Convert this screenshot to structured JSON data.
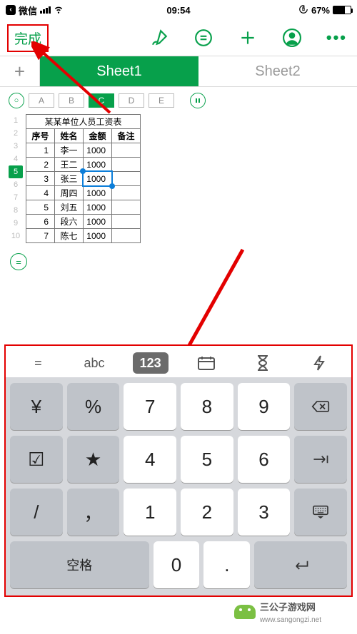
{
  "statusbar": {
    "app": "微信",
    "time": "09:54",
    "battery_pct": "67%"
  },
  "toolbar": {
    "done_label": "完成"
  },
  "sheets": {
    "tab1": "Sheet1",
    "tab2": "Sheet2"
  },
  "cols": {
    "A": "A",
    "B": "B",
    "C": "C",
    "D": "D",
    "E": "E"
  },
  "table": {
    "title": "某某单位人员工资表",
    "headers": {
      "no": "序号",
      "name": "姓名",
      "amount": "金额",
      "note": "备注"
    },
    "rows": [
      {
        "no": "1",
        "name": "李一",
        "amount": "1000",
        "note": ""
      },
      {
        "no": "2",
        "name": "王二",
        "amount": "1000",
        "note": ""
      },
      {
        "no": "3",
        "name": "张三",
        "amount": "1000",
        "note": ""
      },
      {
        "no": "4",
        "name": "周四",
        "amount": "1000",
        "note": ""
      },
      {
        "no": "5",
        "name": "刘五",
        "amount": "1000",
        "note": ""
      },
      {
        "no": "6",
        "name": "段六",
        "amount": "1000",
        "note": ""
      },
      {
        "no": "7",
        "name": "陈七",
        "amount": "1000",
        "note": ""
      }
    ]
  },
  "keyboard": {
    "mode_eq": "=",
    "mode_abc": "abc",
    "mode_123": "123",
    "r1": [
      "¥",
      "%",
      "7",
      "8",
      "9"
    ],
    "r2": [
      "☑",
      "★",
      "4",
      "5",
      "6"
    ],
    "r3": [
      "/",
      "，",
      "1",
      "2",
      "3"
    ],
    "space": "空格",
    "zero": "0",
    "dot": "."
  },
  "watermark": {
    "brand": "三公子游戏网",
    "url": "www.sangongzi.net"
  }
}
